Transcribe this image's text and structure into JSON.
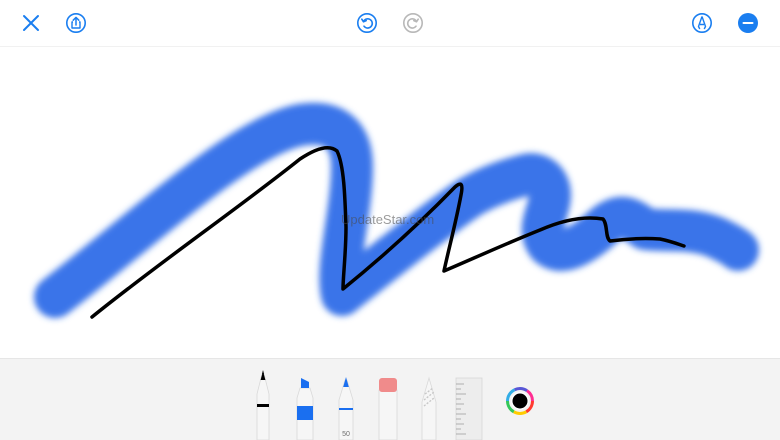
{
  "toolbar": {
    "close_icon": "close-icon",
    "share_icon": "share-icon",
    "undo_icon": "undo-icon",
    "redo_icon": "redo-icon",
    "markup_icon": "markup-pen-icon",
    "more_icon": "minus-circle-icon",
    "accent_color": "#1a7ef0",
    "disabled_color": "#b8b8b8"
  },
  "canvas": {
    "watermark": "UpdateStar.com",
    "highlighter_stroke_color": "#2f6ee8",
    "pen_stroke_color": "#000000"
  },
  "tool_palette": {
    "tools": [
      {
        "name": "pen",
        "color": "#000000"
      },
      {
        "name": "marker",
        "color": "#1a6ff0"
      },
      {
        "name": "pencil",
        "color": "#1a6ff0",
        "size_label": "50"
      },
      {
        "name": "eraser",
        "color": "#f08b8b"
      },
      {
        "name": "lasso",
        "color": "#c8c8c8"
      },
      {
        "name": "ruler",
        "color": "#ededed"
      }
    ],
    "selected_color": "#000000"
  }
}
